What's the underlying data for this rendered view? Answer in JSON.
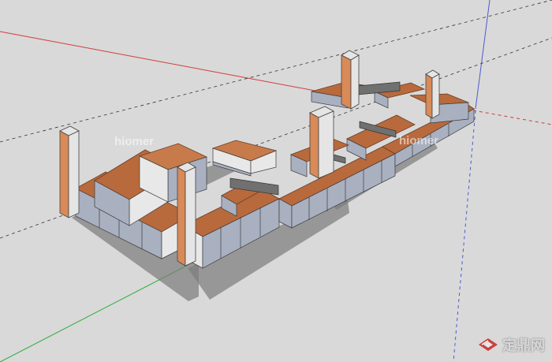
{
  "viewport": {
    "background": "#d9d9d9"
  },
  "watermarks": {
    "left": "hiomer",
    "right": "hiomer"
  },
  "brand": {
    "logo_icon": "diamond-logo-icon",
    "text": "定鼎网"
  },
  "colors": {
    "red_axis": "#d13c3c",
    "green_axis": "#2fae3a",
    "blue_axis": "#4b5bd0",
    "desk": "#b86a3d",
    "cabinet": "#a9b0c0"
  }
}
